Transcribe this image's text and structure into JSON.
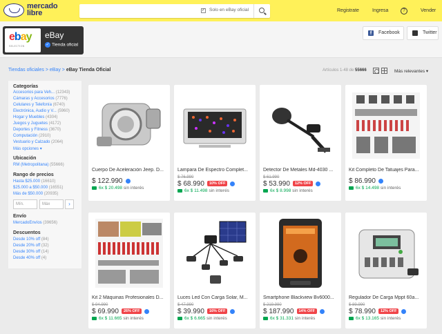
{
  "header": {
    "logo_text": "mercado libre",
    "search_scope_label": "Solo en eBay oficial",
    "nav": [
      "Registrate",
      "Ingresa",
      "Vender"
    ]
  },
  "store": {
    "logo_word": "ebay",
    "logo_sub": "SELECTION",
    "name": "eBay",
    "badge": "Tienda oficial",
    "social": [
      "Facebook",
      "Twitter"
    ]
  },
  "breadcrumb": {
    "items": [
      "Tiendas oficiales",
      "eBay"
    ],
    "current": "eBay Tienda Oficial",
    "separator": " > "
  },
  "toolbar": {
    "results_prefix": "Artículos 1-48 de",
    "results_count": "55666",
    "sort_label": "Más relevantes"
  },
  "sidebar": {
    "categories_title": "Categorías",
    "categories": [
      {
        "label": "Accesorios para Veh...",
        "count": "(12343)"
      },
      {
        "label": "Cámaras y Accesorios",
        "count": "(7776)"
      },
      {
        "label": "Celulares y Telefonía",
        "count": "(6740)"
      },
      {
        "label": "Electrónica, Audio y V...",
        "count": "(5960)"
      },
      {
        "label": "Hogar y Muebles",
        "count": "(4304)"
      },
      {
        "label": "Juegos y Juguetes",
        "count": "(4172)"
      },
      {
        "label": "Deportes y Fitness",
        "count": "(3670)"
      },
      {
        "label": "Computación",
        "count": "(2910)"
      },
      {
        "label": "Vestuario y Calzado",
        "count": "(2064)"
      }
    ],
    "more_label": "Más opciones",
    "location_title": "Ubicación",
    "location": {
      "label": "RM (Metropolitana)",
      "count": "(55666)"
    },
    "price_title": "Rango de precios",
    "prices": [
      {
        "label": "Hasta $25.000",
        "count": "(16610)"
      },
      {
        "label": "$25.000 a $50.000",
        "count": "(16551)"
      },
      {
        "label": "Más de $50.000",
        "count": "(20935)"
      }
    ],
    "min_placeholder": "Mín.",
    "max_placeholder": "Máx",
    "shipping_title": "Envío",
    "shipping": {
      "label": "MercadoEnvíos",
      "count": "(39656)"
    },
    "discounts_title": "Descuentos",
    "discounts": [
      {
        "label": "Desde 10% off",
        "count": "(84)"
      },
      {
        "label": "Desde 20% off",
        "count": "(32)"
      },
      {
        "label": "Desde 30% off",
        "count": "(14)"
      },
      {
        "label": "Desde 40% off",
        "count": "(4)"
      }
    ]
  },
  "products": [
    {
      "title": "Cuerpo De Aceleración Jeep. D...",
      "old_price": "",
      "price": "$ 122.990",
      "off": "",
      "installments": "6x $ 20.498",
      "suffix": "sin interés",
      "icon": "throttle-body"
    },
    {
      "title": "Lampara De Espectro Complet...",
      "old_price": "$ 76.990",
      "price": "$ 68.990",
      "off": "10% OFF",
      "installments": "6x $ 11.498",
      "suffix": "sin interés",
      "icon": "led-grow-lamp"
    },
    {
      "title": "Detector De Metales Md-4030 ...",
      "old_price": "$ 61.990",
      "price": "$ 53.990",
      "off": "12% OFF",
      "installments": "6x $ 8.998",
      "suffix": "sin interés",
      "icon": "metal-detector"
    },
    {
      "title": "Kit Completo De Tatuajes Para...",
      "old_price": "",
      "price": "$ 86.990",
      "off": "",
      "installments": "6x $ 14.498",
      "suffix": "sin interés",
      "icon": "tattoo-kit"
    },
    {
      "title": "Kit 2 Máquinas Profesionales D...",
      "old_price": "$ 94.990",
      "price": "$ 69.990",
      "off": "26% OFF",
      "installments": "6x $ 11.665",
      "suffix": "sin interés",
      "icon": "tattoo-machines"
    },
    {
      "title": "Luces Led Con Carga Solar, M...",
      "old_price": "$ 47.990",
      "price": "$ 39.990",
      "off": "16% OFF",
      "installments": "6x $ 6.665",
      "suffix": "sin interés",
      "icon": "solar-lights"
    },
    {
      "title": "Smartphone Blackview Bv6000...",
      "old_price": "$ 219.990",
      "price": "$ 187.990",
      "off": "14% OFF",
      "installments": "6x $ 31.331",
      "suffix": "sin interés",
      "icon": "rugged-phone"
    },
    {
      "title": "Regulador De Carga Mppt 60a...",
      "old_price": "$ 89.990",
      "price": "$ 78.990",
      "off": "12% OFF",
      "installments": "6x $ 13.165",
      "suffix": "sin interés",
      "icon": "charge-controller"
    }
  ]
}
